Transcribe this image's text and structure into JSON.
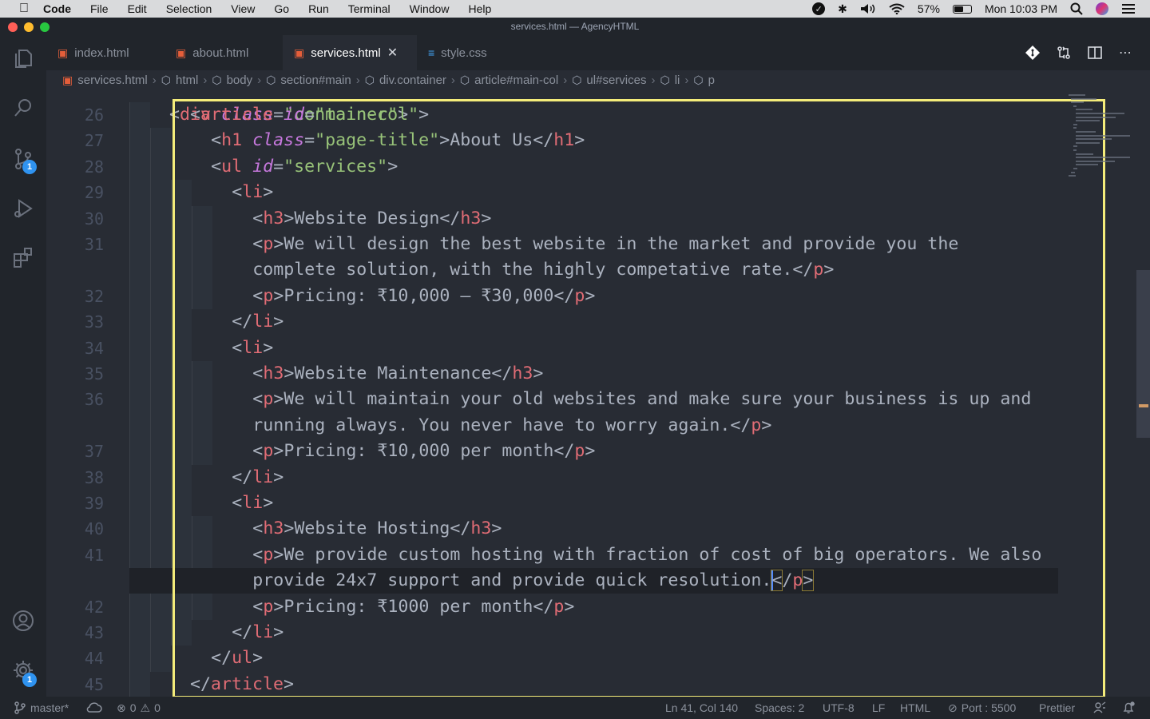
{
  "menubar": {
    "app_name": "Code",
    "items": [
      "File",
      "Edit",
      "Selection",
      "View",
      "Go",
      "Run",
      "Terminal",
      "Window",
      "Help"
    ],
    "battery": "57%",
    "battery_level": 0.57,
    "clock": "Mon 10:03 PM"
  },
  "window": {
    "title": "services.html — AgencyHTML",
    "traffic_colors": [
      "#ff5f57",
      "#febc2e",
      "#28c840"
    ]
  },
  "activity_bar": {
    "scm_badge": "1",
    "settings_badge": "1"
  },
  "tabs": [
    {
      "label": "index.html",
      "icon": "html5-icon",
      "active": false
    },
    {
      "label": "about.html",
      "icon": "html5-icon",
      "active": false
    },
    {
      "label": "services.html",
      "icon": "html5-icon",
      "active": true
    },
    {
      "label": "style.css",
      "icon": "css3-icon",
      "active": false
    }
  ],
  "breadcrumb": [
    "services.html",
    "html",
    "body",
    "section#main",
    "div.container",
    "article#main-col",
    "ul#services",
    "li",
    "p"
  ],
  "editor": {
    "partial_top_line": "<div class=\"container\">",
    "lines": [
      {
        "n": "26",
        "indent": 0,
        "html": "<article id=\"main-col\">"
      },
      {
        "n": "27",
        "indent": 1,
        "html": "<h1 class=\"page-title\">About Us</h1>"
      },
      {
        "n": "28",
        "indent": 1,
        "html": "<ul id=\"services\">"
      },
      {
        "n": "29",
        "indent": 2,
        "html": "<li>"
      },
      {
        "n": "30",
        "indent": 3,
        "html": "<h3>Website Design</h3>"
      },
      {
        "n": "31",
        "indent": 3,
        "html": "<p>We will design the best website in the market and provide you the"
      },
      {
        "n": "",
        "indent": 3,
        "html": "complete solution, with the highly competative rate.</p>"
      },
      {
        "n": "32",
        "indent": 3,
        "html": "<p>Pricing: ₹10,000 – ₹30,000</p>"
      },
      {
        "n": "33",
        "indent": 2,
        "html": "</li>"
      },
      {
        "n": "34",
        "indent": 2,
        "html": "<li>"
      },
      {
        "n": "35",
        "indent": 3,
        "html": "<h3>Website Maintenance</h3>"
      },
      {
        "n": "36",
        "indent": 3,
        "html": "<p>We will maintain your old websites and make sure your business is up and"
      },
      {
        "n": "",
        "indent": 3,
        "html": "running always. You never have to worry again.</p>"
      },
      {
        "n": "37",
        "indent": 3,
        "html": "<p>Pricing: ₹10,000 per month</p>"
      },
      {
        "n": "38",
        "indent": 2,
        "html": "</li>"
      },
      {
        "n": "39",
        "indent": 2,
        "html": "<li>"
      },
      {
        "n": "40",
        "indent": 3,
        "html": "<h3>Website Hosting</h3>"
      },
      {
        "n": "41",
        "indent": 3,
        "html": "<p>We provide custom hosting with fraction of cost of big operators. We also"
      },
      {
        "n": "",
        "indent": 3,
        "html": "provide 24x7 support and provide quick resolution.</p>",
        "current": true
      },
      {
        "n": "42",
        "indent": 3,
        "html": "<p>Pricing: ₹1000 per month</p>"
      },
      {
        "n": "43",
        "indent": 2,
        "html": "</li>"
      },
      {
        "n": "44",
        "indent": 1,
        "html": "</ul>"
      },
      {
        "n": "45",
        "indent": 0,
        "html": "</article>"
      }
    ]
  },
  "statusbar": {
    "branch": "master*",
    "errors": "0",
    "warnings": "0",
    "position": "Ln 41, Col 140",
    "spaces": "Spaces: 2",
    "encoding": "UTF-8",
    "eol": "LF",
    "language": "HTML",
    "port": "Port : 5500",
    "formatter": "Prettier"
  },
  "colors": {
    "highlight_box": "#f4ec7a",
    "html_icon": "#e45e3a",
    "css_icon": "#42a5f5",
    "badge": "#2f93f0"
  }
}
